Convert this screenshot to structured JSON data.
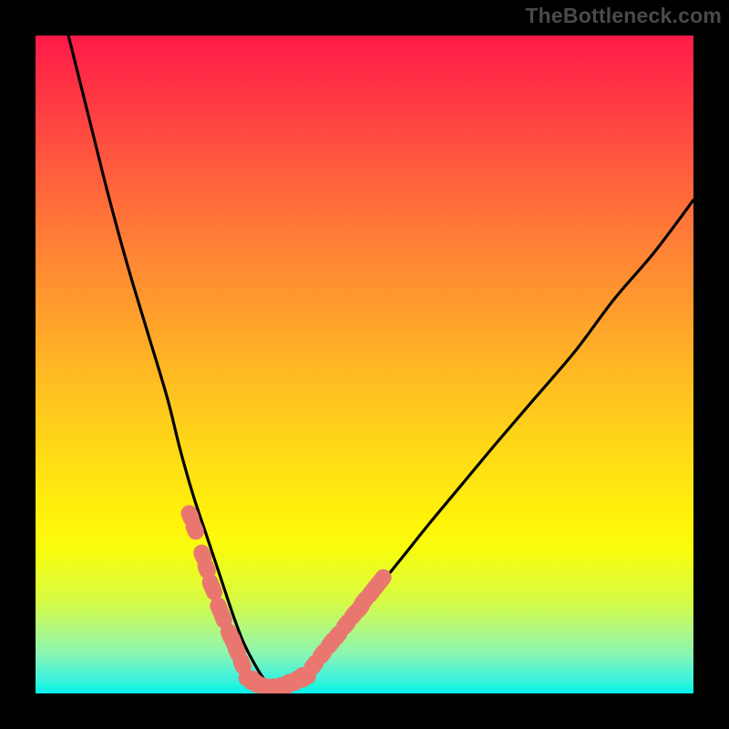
{
  "watermark": "TheBottleneck.com",
  "colors": {
    "frame": "#000000",
    "watermark_text": "#4a4a4a",
    "curve": "#000000",
    "dot_fill": "#e9776f",
    "gradient_stops": [
      "#ff1a49",
      "#ff2d45",
      "#ff5140",
      "#ff7b37",
      "#ffa12c",
      "#ffc41f",
      "#ffe114",
      "#fff40a",
      "#f8fc0c",
      "#e8fc28",
      "#d6fb44",
      "#b3f97e",
      "#8af5b2",
      "#4cf2d6",
      "#19f0e6"
    ]
  },
  "chart_data": {
    "type": "line",
    "title": "",
    "xlabel": "",
    "ylabel": "",
    "xlim": [
      0,
      100
    ],
    "ylim": [
      0,
      100
    ],
    "grid": false,
    "legend": false,
    "series": [
      {
        "name": "v-curve",
        "x": [
          5,
          8,
          11,
          14,
          17,
          20,
          22,
          24,
          26,
          28,
          30,
          31.5,
          33,
          34.5,
          36,
          38,
          40,
          43,
          46,
          49,
          52,
          56,
          60,
          65,
          70,
          76,
          82,
          88,
          94,
          100
        ],
        "values": [
          100,
          88,
          76,
          65,
          55,
          45,
          37,
          30,
          24,
          18,
          12,
          8,
          5,
          2.5,
          1,
          1,
          2,
          5,
          8.5,
          12,
          16,
          21,
          26,
          32,
          38,
          45,
          52,
          60,
          67,
          75
        ]
      }
    ],
    "highlight_cluster_left": {
      "x": [
        23.5,
        24.2,
        25.4,
        26.0,
        26.7,
        27.0,
        27.9,
        28.5,
        29.5,
        30.0,
        30.6,
        31.4
      ],
      "values": [
        27,
        25,
        21,
        19,
        16.5,
        15.8,
        13,
        11.5,
        9,
        8,
        6.5,
        4.5
      ]
    },
    "highlight_cluster_bottom": {
      "x": [
        32.5,
        33.2,
        34.0,
        35.3,
        36.6,
        37.8,
        39.0,
        40.2,
        41.0
      ],
      "values": [
        2.3,
        1.7,
        1.3,
        1.0,
        1.0,
        1.2,
        1.7,
        2.2,
        2.7
      ]
    },
    "highlight_cluster_right": {
      "x": [
        42.3,
        43.6,
        44.8,
        45.0,
        45.9,
        47.2,
        48.4,
        49.3,
        49.9,
        51.0,
        51.8,
        52.6
      ],
      "values": [
        4.3,
        6.0,
        7.5,
        7.8,
        8.8,
        10.5,
        12.0,
        13.0,
        14.0,
        15.3,
        16.3,
        17.3
      ]
    }
  }
}
